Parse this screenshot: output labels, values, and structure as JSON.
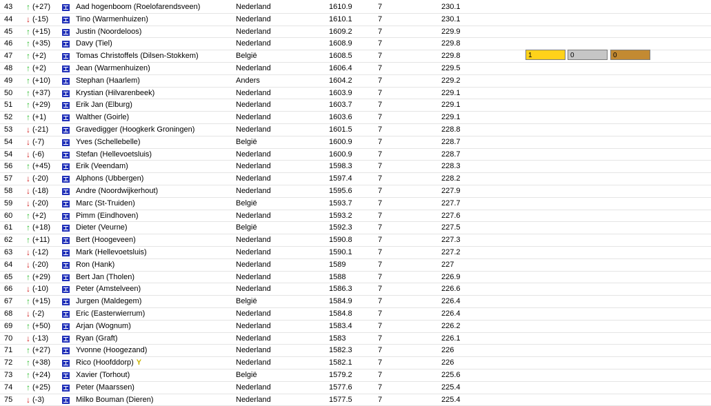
{
  "rows": [
    {
      "rank": "43",
      "dir": "up",
      "change": "(+27)",
      "name": "Aad hogenboom (Roelofarendsveen)",
      "country": "Nederland",
      "rating": "1610.9",
      "games": "7",
      "score": "230.1"
    },
    {
      "rank": "44",
      "dir": "down",
      "change": "(-15)",
      "name": "Tino (Warmenhuizen)",
      "country": "Nederland",
      "rating": "1610.1",
      "games": "7",
      "score": "230.1"
    },
    {
      "rank": "45",
      "dir": "up",
      "change": "(+15)",
      "name": "Justin (Noordeloos)",
      "country": "Nederland",
      "rating": "1609.2",
      "games": "7",
      "score": "229.9"
    },
    {
      "rank": "46",
      "dir": "up",
      "change": "(+35)",
      "name": "Davy (Tiel)",
      "country": "Nederland",
      "rating": "1608.9",
      "games": "7",
      "score": "229.8"
    },
    {
      "rank": "47",
      "dir": "up",
      "change": "(+2)",
      "name": "Tomas Christoffels (Dilsen-Stokkem)",
      "country": "België",
      "rating": "1608.5",
      "games": "7",
      "score": "229.8",
      "medals": {
        "gold": "1",
        "silver": "0",
        "bronze": "0"
      }
    },
    {
      "rank": "48",
      "dir": "up",
      "change": "(+2)",
      "name": "Jean (Warmenhuizen)",
      "country": "Nederland",
      "rating": "1606.4",
      "games": "7",
      "score": "229.5"
    },
    {
      "rank": "49",
      "dir": "up",
      "change": "(+10)",
      "name": "Stephan (Haarlem)",
      "country": "Anders",
      "rating": "1604.2",
      "games": "7",
      "score": "229.2"
    },
    {
      "rank": "50",
      "dir": "up",
      "change": "(+37)",
      "name": "Krystian (Hilvarenbeek)",
      "country": "Nederland",
      "rating": "1603.9",
      "games": "7",
      "score": "229.1"
    },
    {
      "rank": "51",
      "dir": "up",
      "change": "(+29)",
      "name": "Erik Jan (Elburg)",
      "country": "Nederland",
      "rating": "1603.7",
      "games": "7",
      "score": "229.1"
    },
    {
      "rank": "52",
      "dir": "up",
      "change": "(+1)",
      "name": "Walther (Goirle)",
      "country": "Nederland",
      "rating": "1603.6",
      "games": "7",
      "score": "229.1"
    },
    {
      "rank": "53",
      "dir": "down",
      "change": "(-21)",
      "name": "Gravedigger (Hoogkerk Groningen)",
      "country": "Nederland",
      "rating": "1601.5",
      "games": "7",
      "score": "228.8"
    },
    {
      "rank": "54",
      "dir": "down",
      "change": "(-7)",
      "name": "Yves (Schellebelle)",
      "country": "België",
      "rating": "1600.9",
      "games": "7",
      "score": "228.7"
    },
    {
      "rank": "54",
      "dir": "down",
      "change": "(-6)",
      "name": "Stefan (Hellevoetsluis)",
      "country": "Nederland",
      "rating": "1600.9",
      "games": "7",
      "score": "228.7"
    },
    {
      "rank": "56",
      "dir": "up",
      "change": "(+45)",
      "name": "Erik (Veendam)",
      "country": "Nederland",
      "rating": "1598.3",
      "games": "7",
      "score": "228.3"
    },
    {
      "rank": "57",
      "dir": "down",
      "change": "(-20)",
      "name": "Alphons (Ubbergen)",
      "country": "Nederland",
      "rating": "1597.4",
      "games": "7",
      "score": "228.2"
    },
    {
      "rank": "58",
      "dir": "down",
      "change": "(-18)",
      "name": "Andre (Noordwijkerhout)",
      "country": "Nederland",
      "rating": "1595.6",
      "games": "7",
      "score": "227.9"
    },
    {
      "rank": "59",
      "dir": "down",
      "change": "(-20)",
      "name": "Marc (St-Truiden)",
      "country": "België",
      "rating": "1593.7",
      "games": "7",
      "score": "227.7"
    },
    {
      "rank": "60",
      "dir": "up",
      "change": "(+2)",
      "name": "Pimm (Eindhoven)",
      "country": "Nederland",
      "rating": "1593.2",
      "games": "7",
      "score": "227.6"
    },
    {
      "rank": "61",
      "dir": "up",
      "change": "(+18)",
      "name": "Dieter (Veurne)",
      "country": "België",
      "rating": "1592.3",
      "games": "7",
      "score": "227.5"
    },
    {
      "rank": "62",
      "dir": "up",
      "change": "(+11)",
      "name": "Bert (Hoogeveen)",
      "country": "Nederland",
      "rating": "1590.8",
      "games": "7",
      "score": "227.3"
    },
    {
      "rank": "63",
      "dir": "down",
      "change": "(-12)",
      "name": "Mark (Hellevoetsluis)",
      "country": "Nederland",
      "rating": "1590.1",
      "games": "7",
      "score": "227.2"
    },
    {
      "rank": "64",
      "dir": "down",
      "change": "(-20)",
      "name": "Ron (Hank)",
      "country": "Nederland",
      "rating": "1589",
      "games": "7",
      "score": "227"
    },
    {
      "rank": "65",
      "dir": "up",
      "change": "(+29)",
      "name": "Bert Jan (Tholen)",
      "country": "Nederland",
      "rating": "1588",
      "games": "7",
      "score": "226.9"
    },
    {
      "rank": "66",
      "dir": "down",
      "change": "(-10)",
      "name": "Peter (Amstelveen)",
      "country": "Nederland",
      "rating": "1586.3",
      "games": "7",
      "score": "226.6"
    },
    {
      "rank": "67",
      "dir": "up",
      "change": "(+15)",
      "name": "Jurgen (Maldegem)",
      "country": "België",
      "rating": "1584.9",
      "games": "7",
      "score": "226.4"
    },
    {
      "rank": "68",
      "dir": "down",
      "change": "(-2)",
      "name": "Eric (Easterwierrum)",
      "country": "Nederland",
      "rating": "1584.8",
      "games": "7",
      "score": "226.4"
    },
    {
      "rank": "69",
      "dir": "up",
      "change": "(+50)",
      "name": "Arjan (Wognum)",
      "country": "Nederland",
      "rating": "1583.4",
      "games": "7",
      "score": "226.2"
    },
    {
      "rank": "70",
      "dir": "down",
      "change": "(-13)",
      "name": "Ryan (Graft)",
      "country": "Nederland",
      "rating": "1583",
      "games": "7",
      "score": "226.1"
    },
    {
      "rank": "71",
      "dir": "up",
      "change": "(+27)",
      "name": "Yvonne (Hoogezand)",
      "country": "Nederland",
      "rating": "1582.3",
      "games": "7",
      "score": "226"
    },
    {
      "rank": "72",
      "dir": "up",
      "change": "(+38)",
      "name": "Rico (Hoofddorp)",
      "country": "Nederland",
      "rating": "1582.1",
      "games": "7",
      "score": "226",
      "trophy": true
    },
    {
      "rank": "73",
      "dir": "up",
      "change": "(+24)",
      "name": "Xavier (Torhout)",
      "country": "België",
      "rating": "1579.2",
      "games": "7",
      "score": "225.6"
    },
    {
      "rank": "74",
      "dir": "up",
      "change": "(+25)",
      "name": "Peter (Maarssen)",
      "country": "Nederland",
      "rating": "1577.6",
      "games": "7",
      "score": "225.4"
    },
    {
      "rank": "75",
      "dir": "down",
      "change": "(-3)",
      "name": "Milko Bouman (Dieren)",
      "country": "Nederland",
      "rating": "1577.5",
      "games": "7",
      "score": "225.4"
    }
  ],
  "icons": {
    "up": "arrow-up-icon",
    "down": "arrow-down-icon",
    "flag": "chess-board-icon",
    "trophy": "trophy-icon"
  },
  "colors": {
    "up": "#22b922",
    "down": "#d01010",
    "gold": "#ffd21a",
    "silver": "#c6c6c6",
    "bronze": "#c38a32",
    "flag": "#1f2fb8"
  }
}
